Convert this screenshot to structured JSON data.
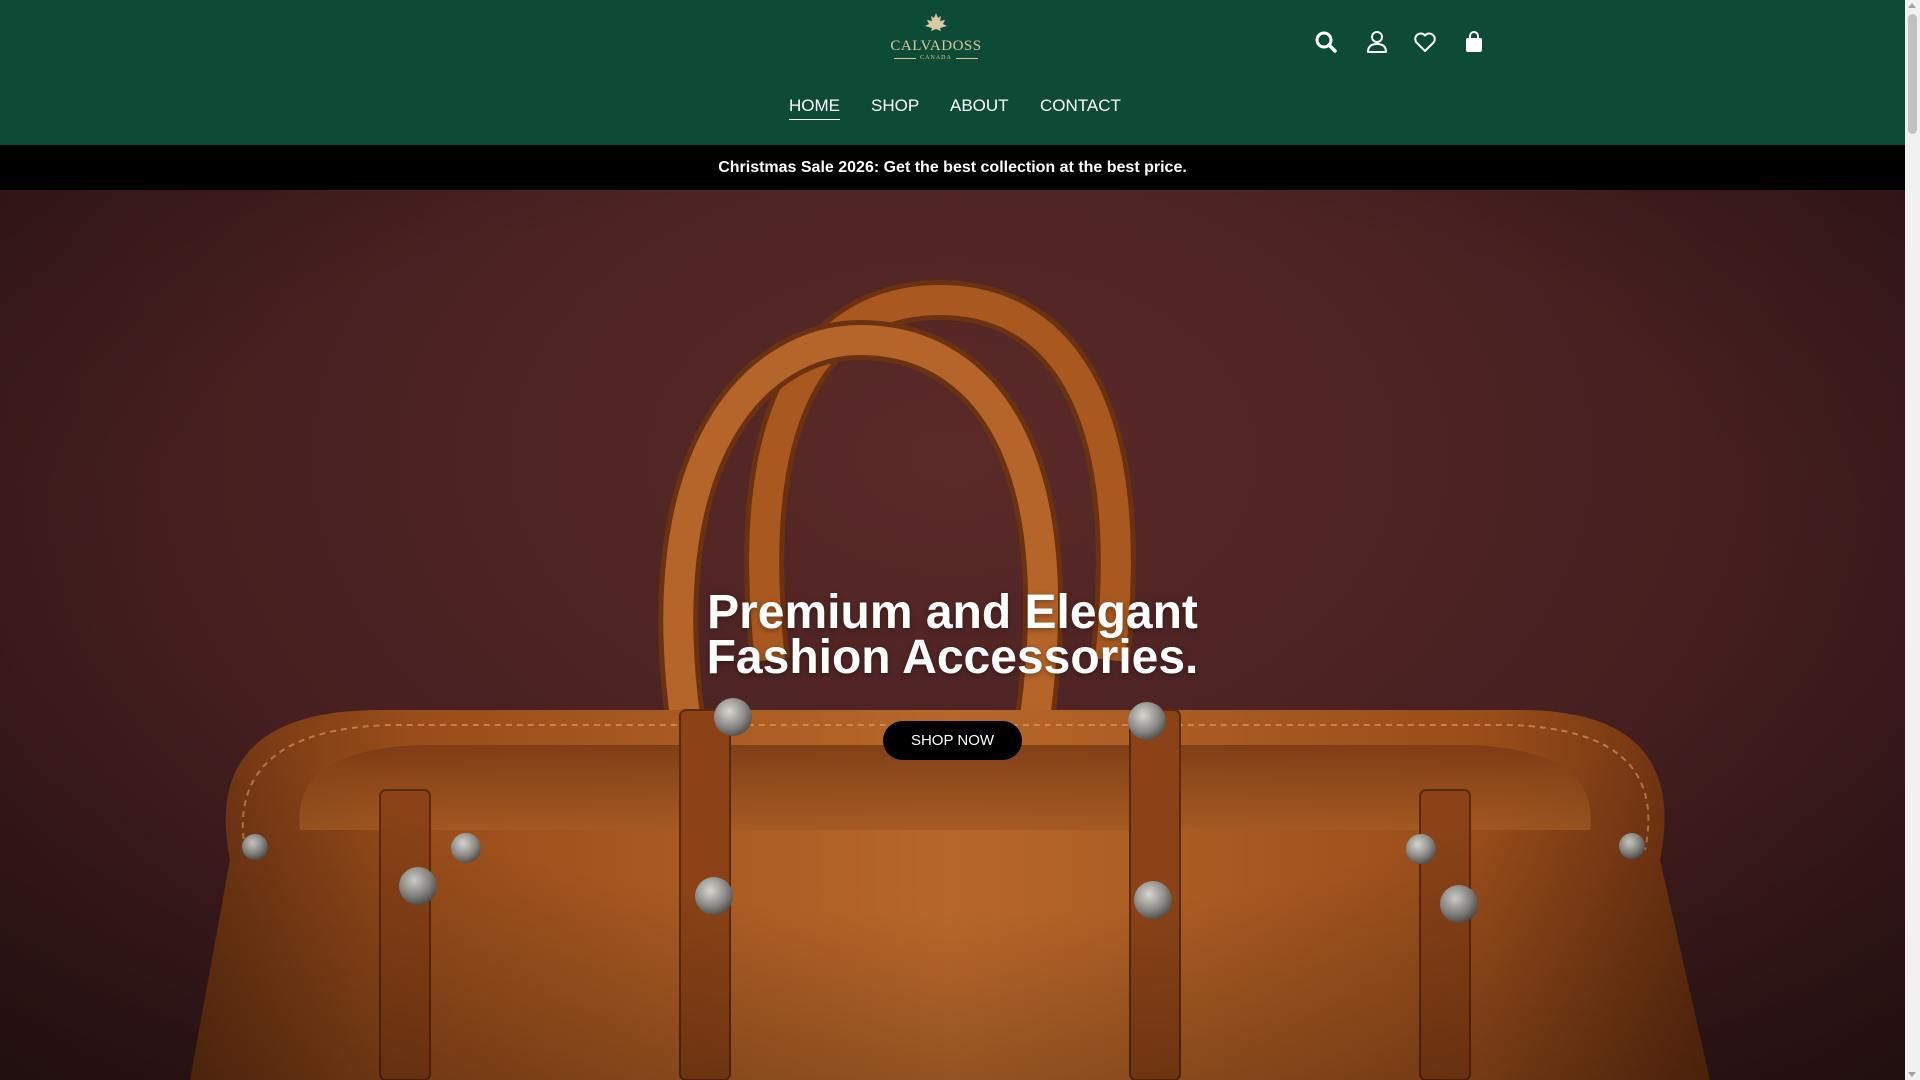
{
  "brand": {
    "name": "CALVADOSS",
    "sub": "CANADA",
    "logo_color": "#d8c9a4"
  },
  "header": {
    "background": "#0e4b36",
    "icons": [
      "search-icon",
      "user-icon",
      "heart-icon",
      "shopping-bag-icon"
    ]
  },
  "nav": {
    "items": [
      {
        "label": "HOME",
        "active": true
      },
      {
        "label": "SHOP",
        "active": false
      },
      {
        "label": "ABOUT",
        "active": false
      },
      {
        "label": "CONTACT",
        "active": false
      }
    ]
  },
  "announcement": {
    "text": "Christmas Sale 2026: Get the best collection at the best price."
  },
  "hero": {
    "title_line1": "Premium and Elegant",
    "title_line2": "Fashion Accessories.",
    "button_label": "SHOP NOW",
    "background": "#4a2122",
    "bag_color": "#a4561e"
  }
}
